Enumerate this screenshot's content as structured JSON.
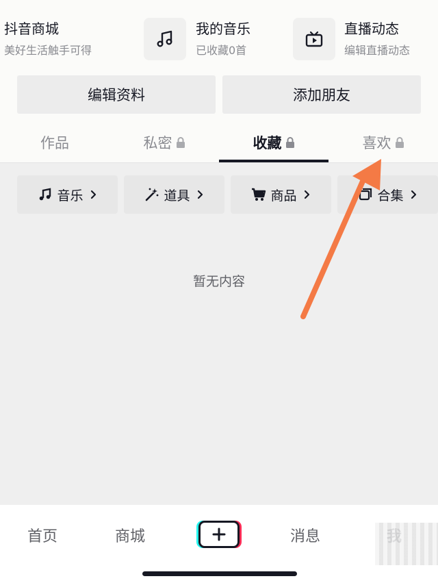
{
  "shortcuts": [
    {
      "title": "抖音商城",
      "subtitle": "美好生活触手可得",
      "icon": "shop-icon"
    },
    {
      "title": "我的音乐",
      "subtitle": "已收藏0首",
      "icon": "music-note-icon"
    },
    {
      "title": "直播动态",
      "subtitle": "编辑直播动态",
      "icon": "tv-play-icon"
    }
  ],
  "actions": {
    "edit_profile": "编辑资料",
    "add_friends": "添加朋友"
  },
  "tabs": [
    {
      "label": "作品",
      "locked": false,
      "active": false
    },
    {
      "label": "私密",
      "locked": true,
      "active": false
    },
    {
      "label": "收藏",
      "locked": true,
      "active": true
    },
    {
      "label": "喜欢",
      "locked": true,
      "active": false
    }
  ],
  "chips": [
    {
      "label": "音乐",
      "icon": "music-note-icon"
    },
    {
      "label": "道具",
      "icon": "magic-wand-icon"
    },
    {
      "label": "商品",
      "icon": "cart-icon"
    },
    {
      "label": "合集",
      "icon": "collection-icon"
    }
  ],
  "empty_state": "暂无内容",
  "bottom_nav": [
    {
      "label": "首页"
    },
    {
      "label": "商城"
    },
    {
      "label": "消息"
    },
    {
      "label": "我"
    }
  ],
  "colors": {
    "text_primary": "#161823",
    "text_secondary": "#8a8b91",
    "annotation_arrow": "#f47a45",
    "accent_cyan": "#25f4ee",
    "accent_red": "#fe2c55"
  }
}
